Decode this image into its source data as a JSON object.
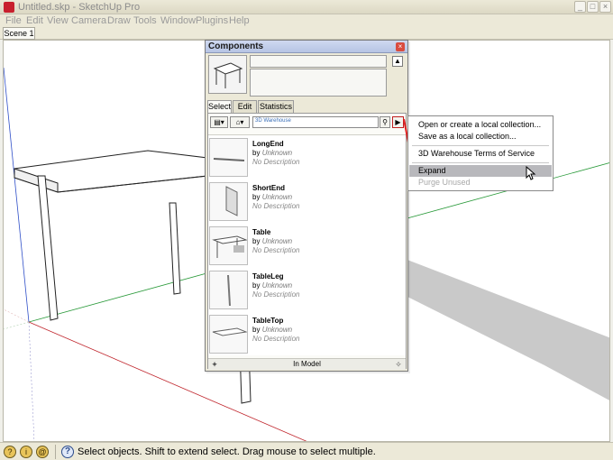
{
  "window": {
    "title": "Untitled.skp - SketchUp Pro",
    "controls": [
      "_",
      "□",
      "×"
    ]
  },
  "menu": [
    "File",
    "Edit",
    "View",
    "Camera",
    "Draw",
    "Tools",
    "Window",
    "Plugins",
    "Help"
  ],
  "scene_tab": "Scene 1",
  "components": {
    "title": "Components",
    "tabs": [
      "Select",
      "Edit",
      "Statistics"
    ],
    "search_label": "3D Warehouse",
    "items": [
      {
        "name": "LongEnd",
        "by": "by",
        "author": "Unknown",
        "description": "No Description"
      },
      {
        "name": "ShortEnd",
        "by": "by",
        "author": "Unknown",
        "description": "No Description"
      },
      {
        "name": "Table",
        "by": "by",
        "author": "Unknown",
        "description": "No Description"
      },
      {
        "name": "TableLeg",
        "by": "by",
        "author": "Unknown",
        "description": "No Description"
      },
      {
        "name": "TableTop",
        "by": "by",
        "author": "Unknown",
        "description": "No Description"
      }
    ],
    "footer_label": "In Model"
  },
  "context_menu": {
    "items": [
      {
        "label": "Open or create a local collection...",
        "state": "normal"
      },
      {
        "label": "Save as a local collection...",
        "state": "normal"
      },
      {
        "label": "3D Warehouse Terms of Service",
        "state": "normal"
      },
      {
        "label": "Expand",
        "state": "highlighted"
      },
      {
        "label": "Purge Unused",
        "state": "disabled"
      }
    ]
  },
  "status": {
    "text": "Select objects. Shift to extend select. Drag mouse to select multiple."
  },
  "colors": {
    "axis_red": "#c0262d",
    "axis_green": "#2a9a3a",
    "axis_blue": "#2f4fc8",
    "highlight": "#b8b8bc",
    "callout_arrow": "#e02020"
  },
  "icons": [
    "sketchup-app-icon",
    "close-icon",
    "details-arrow-icon",
    "view-options-icon",
    "home-icon",
    "search-icon",
    "details-menu-icon",
    "back-arrow-icon",
    "forward-arrow-icon",
    "help-icon",
    "mouse-cursor-icon"
  ]
}
